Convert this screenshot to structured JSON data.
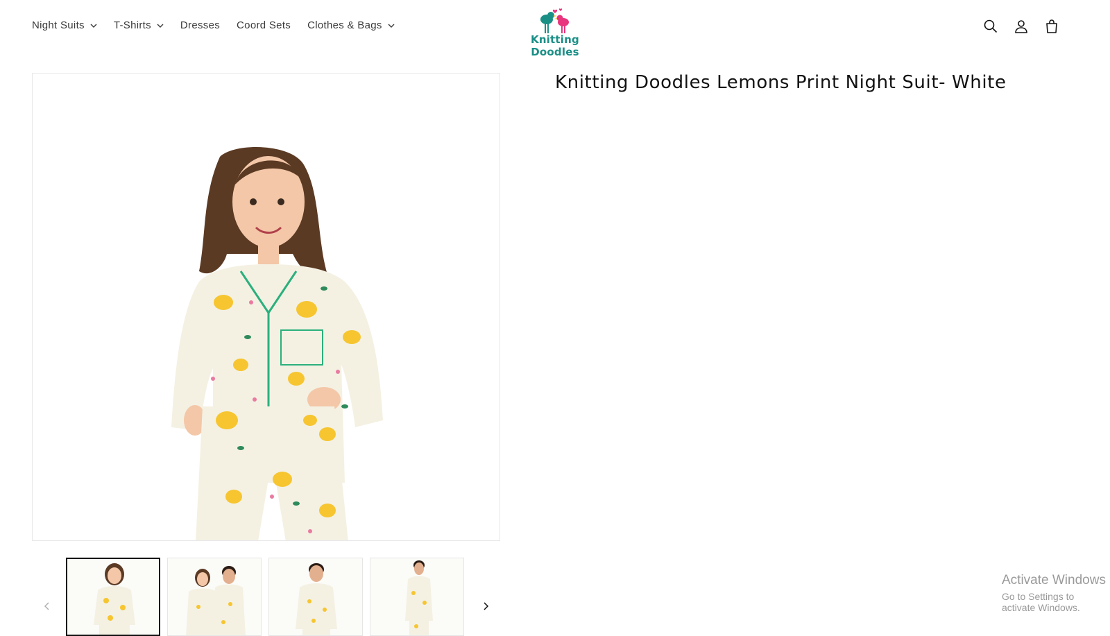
{
  "header": {
    "nav": [
      {
        "label": "Night Suits",
        "has_dropdown": true
      },
      {
        "label": "T-Shirts",
        "has_dropdown": true
      },
      {
        "label": "Dresses",
        "has_dropdown": false
      },
      {
        "label": "Coord Sets",
        "has_dropdown": false
      },
      {
        "label": "Clothes & Bags",
        "has_dropdown": true
      }
    ],
    "logo_text": "Knitting Doodles",
    "icons": [
      "search-icon",
      "account-icon",
      "cart-icon"
    ]
  },
  "product": {
    "title": "Knitting Doodles Lemons Print Night Suit- White"
  },
  "gallery": {
    "active_index": 0,
    "thumbnail_count": 4
  },
  "watermark": {
    "line1": "Activate Windows",
    "line2": "Go to Settings to activate Windows."
  },
  "colors": {
    "logo_teal": "#1a8f86",
    "logo_pink": "#e8357d",
    "text": "#121212"
  }
}
